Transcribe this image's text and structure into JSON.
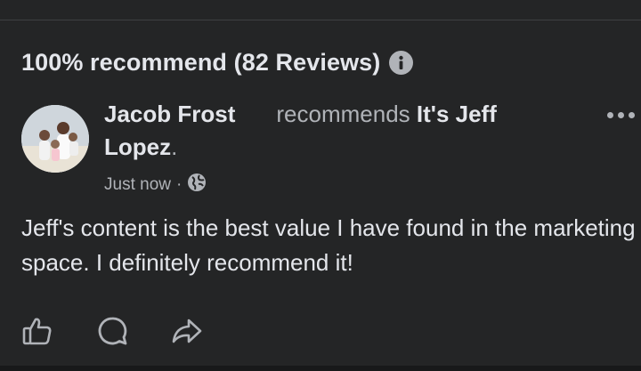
{
  "reviews": {
    "summary": "100% recommend (82 Reviews)"
  },
  "review": {
    "author": "Jacob Frost",
    "verb": "recommends",
    "page_name_part1": "It's Jeff",
    "page_name_part2": "Lopez",
    "period": ".",
    "timestamp": "Just now",
    "separator": "·",
    "privacy_icon": "globe-icon",
    "text": "Jeff's content is the best value I have found in the marketing space. I definitely recommend it!"
  },
  "actions": {
    "like_icon": "thumbs-up-icon",
    "comment_icon": "comment-icon",
    "share_icon": "share-icon"
  },
  "colors": {
    "background": "#242526",
    "primary_text": "#e4e6eb",
    "secondary_text": "#b0b3b8"
  }
}
